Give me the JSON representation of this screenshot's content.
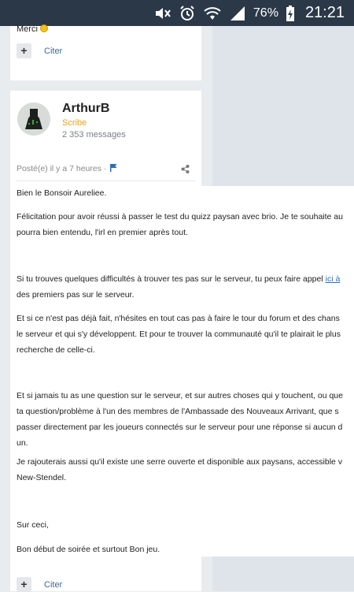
{
  "status_bar": {
    "battery_percent": "76%",
    "time": "21:21",
    "icons": [
      "mute-icon",
      "alarm-icon",
      "wifi-icon",
      "signal-icon",
      "battery-charging-icon"
    ]
  },
  "previous_post": {
    "text": "Merci",
    "emoji": "smiley-icon",
    "quote_label": "Citer"
  },
  "post": {
    "author": "ArthurB",
    "rank": "Scribe",
    "message_count": "2 353 messages",
    "posted": "Posté(e) il y a 7 heures ·",
    "paragraphs": {
      "p1": "Bien le Bonsoir Aureliee.",
      "p2_line1": "Félicitation pour avoir réussi à passer le test du quizz paysan avec brio. Je te souhaite au",
      "p2_line2": "pourra bien entendu, l'irl en premier après tout.",
      "p3_line1": "Si tu trouves quelques difficultés à trouver tes pas sur le serveur, tu peux faire appel ",
      "p3_link": "ici à",
      "p3_line2": "des premiers pas sur le serveur.",
      "p4_line1": "Et si ce n'est pas déjà fait, n'hésites en tout cas pas à faire le tour du forum et des chans",
      "p4_line2": "le serveur et qui s'y développent. Et pour te trouver la communauté qu'il te plairait le plus",
      "p4_line3": "recherche de celle-ci.",
      "p5_line1": "Et si jamais tu as une question sur le serveur, et sur autres choses qui y touchent, ou que",
      "p5_line2": "ta question/problème à l'un des membres de l'Ambassade des Nouveaux Arrivant, que  s",
      "p5_line3": "passer directement par les joueurs connectés sur le serveur pour une réponse si aucun d",
      "p5_line4": "un.",
      "p6_line1": "Je rajouterais aussi qu'il existe une serre ouverte et disponible aux paysans, accessible v",
      "p6_line2": "New-Stendel.",
      "p7": "Sur ceci,",
      "p8": "Bon début de soirée et surtout Bon jeu."
    },
    "quote_label": "Citer"
  },
  "colors": {
    "status_bar_bg": "#2b3848",
    "rank": "#e8a317",
    "link": "#2d6fb5",
    "page_bg": "#e9ecef"
  }
}
